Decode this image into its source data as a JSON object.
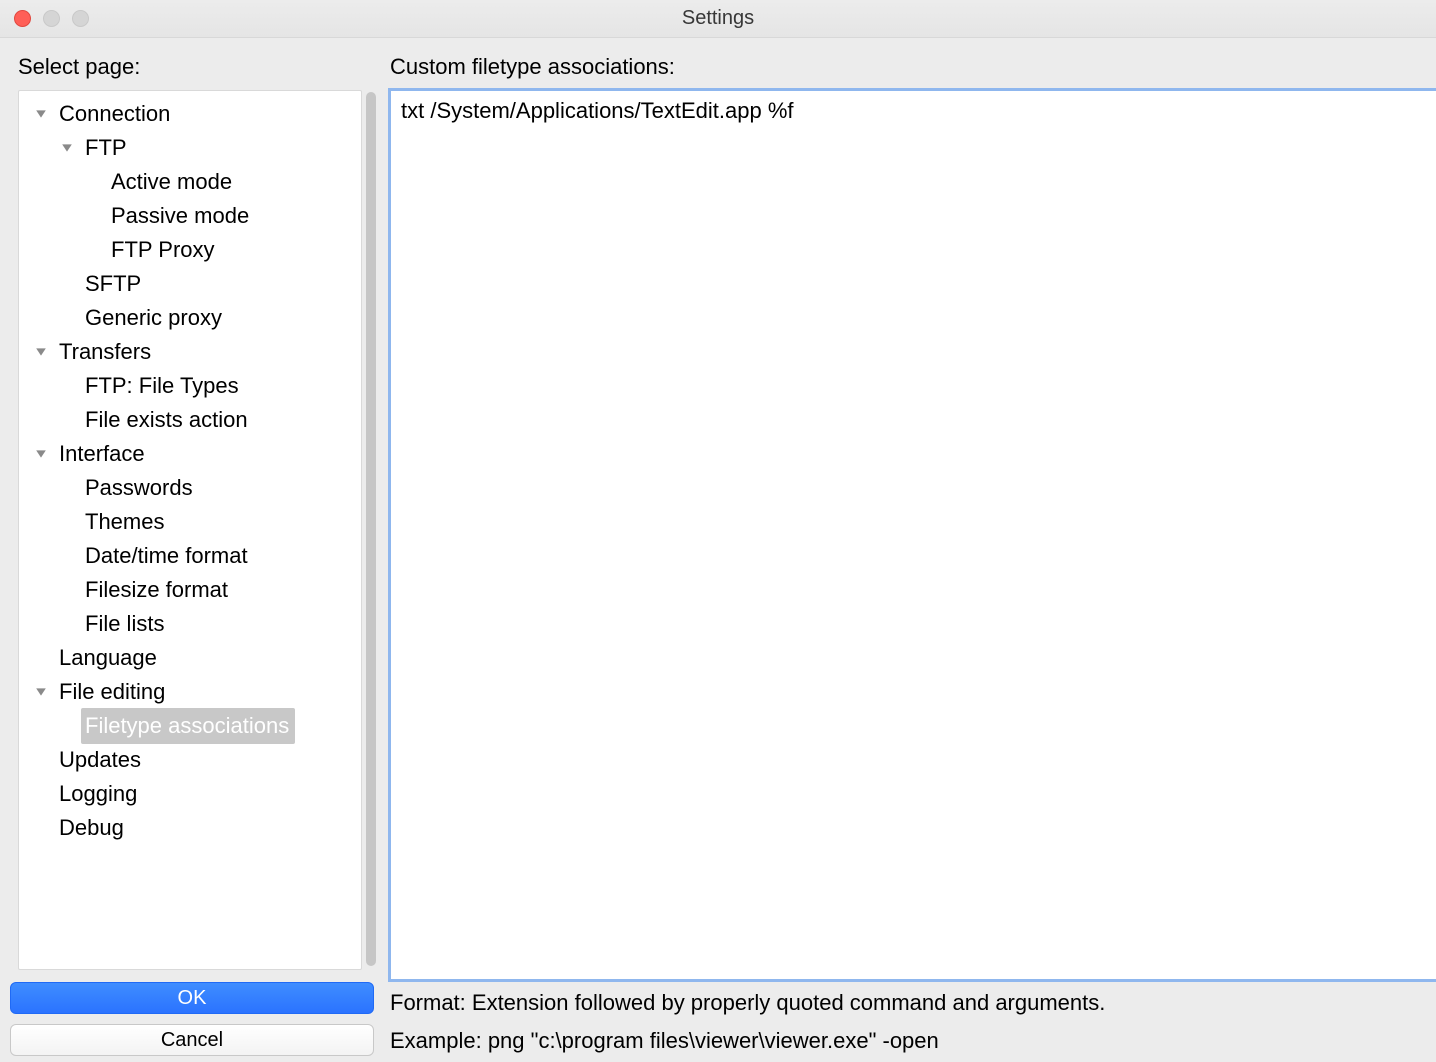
{
  "window": {
    "title": "Settings"
  },
  "left": {
    "label": "Select page:",
    "tree": [
      {
        "label": "Connection",
        "level": 0,
        "arrow": true
      },
      {
        "label": "FTP",
        "level": 1,
        "arrow": true
      },
      {
        "label": "Active mode",
        "level": 2,
        "arrow": false
      },
      {
        "label": "Passive mode",
        "level": 2,
        "arrow": false
      },
      {
        "label": "FTP Proxy",
        "level": 2,
        "arrow": false
      },
      {
        "label": "SFTP",
        "level": 1,
        "arrow": false
      },
      {
        "label": "Generic proxy",
        "level": 1,
        "arrow": false
      },
      {
        "label": "Transfers",
        "level": 0,
        "arrow": true
      },
      {
        "label": "FTP: File Types",
        "level": 1,
        "arrow": false
      },
      {
        "label": "File exists action",
        "level": 1,
        "arrow": false
      },
      {
        "label": "Interface",
        "level": 0,
        "arrow": true
      },
      {
        "label": "Passwords",
        "level": 1,
        "arrow": false
      },
      {
        "label": "Themes",
        "level": 1,
        "arrow": false
      },
      {
        "label": "Date/time format",
        "level": 1,
        "arrow": false
      },
      {
        "label": "Filesize format",
        "level": 1,
        "arrow": false
      },
      {
        "label": "File lists",
        "level": 1,
        "arrow": false
      },
      {
        "label": "Language",
        "level": 0,
        "arrow": false
      },
      {
        "label": "File editing",
        "level": 0,
        "arrow": true
      },
      {
        "label": "Filetype associations",
        "level": 1,
        "arrow": false,
        "selected": true
      },
      {
        "label": "Updates",
        "level": 0,
        "arrow": false
      },
      {
        "label": "Logging",
        "level": 0,
        "arrow": false
      },
      {
        "label": "Debug",
        "level": 0,
        "arrow": false
      }
    ],
    "ok": "OK",
    "cancel": "Cancel"
  },
  "right": {
    "header": "Custom filetype associations:",
    "text": "txt /System/Applications/TextEdit.app %f",
    "format": "Format: Extension followed by properly quoted command and arguments.",
    "example": "Example: png \"c:\\program files\\viewer\\viewer.exe\" -open"
  }
}
